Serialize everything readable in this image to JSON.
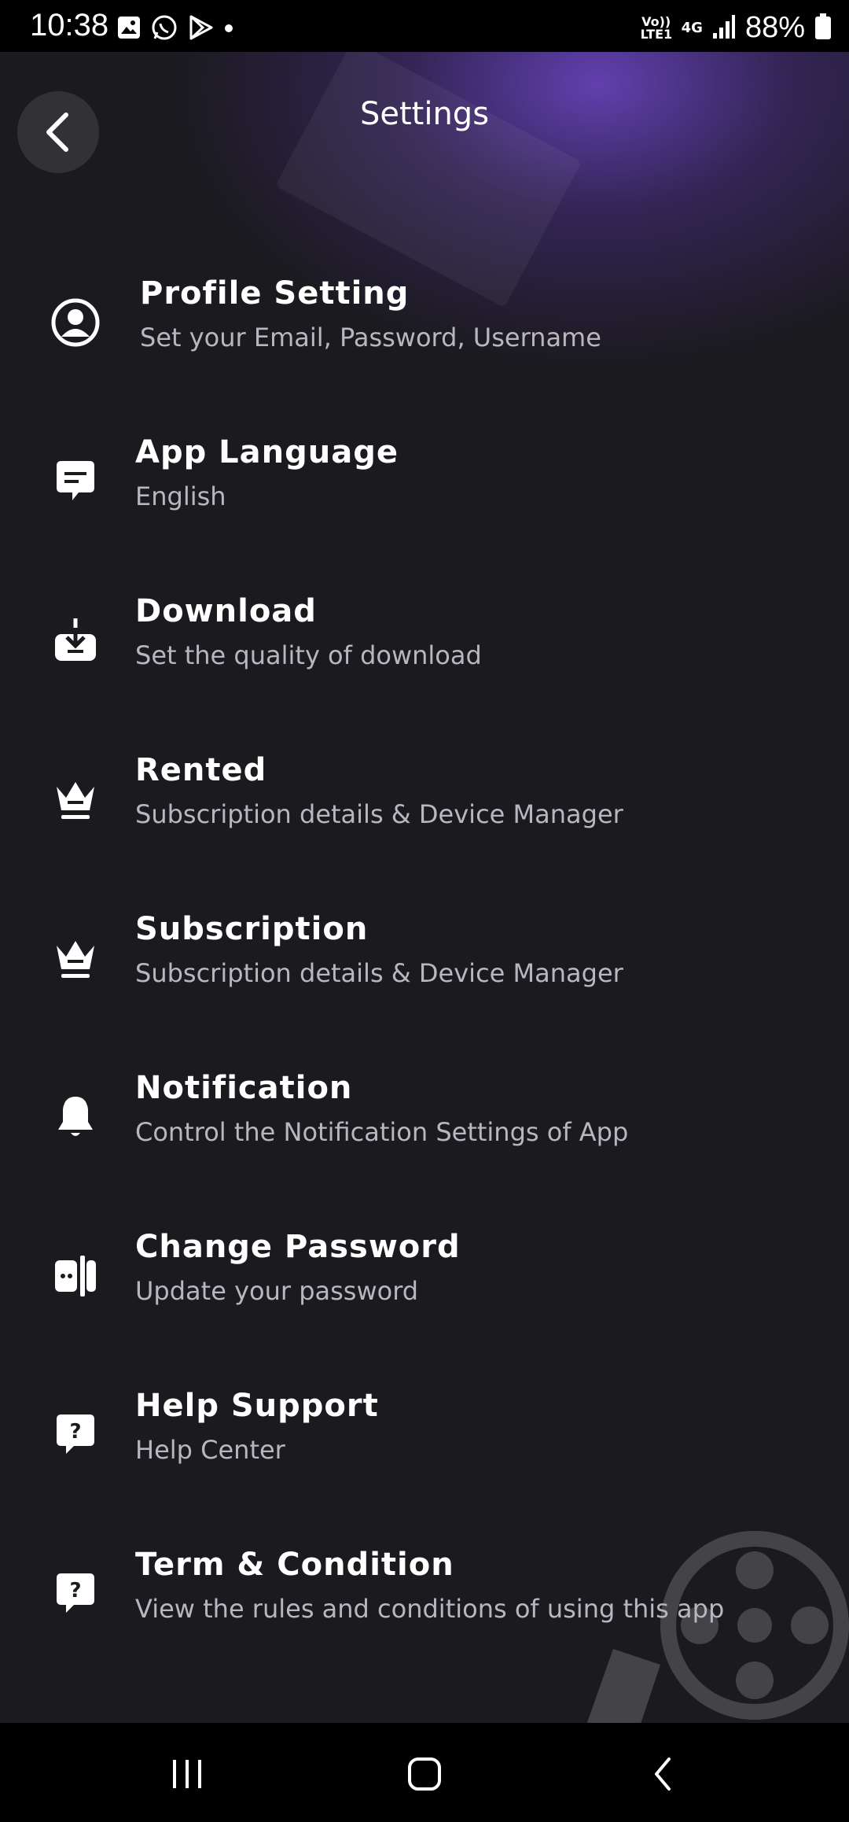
{
  "status": {
    "time": "10:38",
    "network": "Vo)) LTE1",
    "network_gen": "4G",
    "battery": "88%"
  },
  "header": {
    "title": "Settings"
  },
  "items": [
    {
      "title": "Profile Setting",
      "subtitle": "Set your Email, Password, Username",
      "icon": "profile-icon"
    },
    {
      "title": "App Language",
      "subtitle": "English",
      "icon": "chat-language-icon"
    },
    {
      "title": "Download",
      "subtitle": "Set the quality of download",
      "icon": "download-icon"
    },
    {
      "title": "Rented",
      "subtitle": "Subscription details & Device Manager",
      "icon": "crown-icon"
    },
    {
      "title": "Subscription",
      "subtitle": "Subscription details & Device Manager",
      "icon": "crown-icon"
    },
    {
      "title": "Notification",
      "subtitle": "Control the Notification Settings of App",
      "icon": "bell-icon"
    },
    {
      "title": "Change Password",
      "subtitle": "Update your password",
      "icon": "password-icon"
    },
    {
      "title": "Help Support",
      "subtitle": "Help Center",
      "icon": "help-icon"
    },
    {
      "title": "Term & Condition",
      "subtitle": "View the rules and conditions of using this app",
      "icon": "help-icon"
    }
  ],
  "colors": {
    "background": "#1b1a1f",
    "accent": "#6e46c8",
    "subtitle": "#b9b6bf"
  }
}
